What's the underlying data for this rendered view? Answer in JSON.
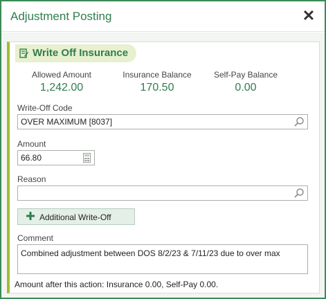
{
  "dialog": {
    "title": "Adjustment Posting",
    "close_symbol": "✕"
  },
  "section": {
    "title": "Write Off Insurance",
    "icon": "document-edit-icon"
  },
  "stats": [
    {
      "label": "Allowed Amount",
      "value": "1,242.00"
    },
    {
      "label": "Insurance Balance",
      "value": "170.50"
    },
    {
      "label": "Self-Pay Balance",
      "value": "0.00"
    }
  ],
  "form": {
    "writeoff_code": {
      "label": "Write-Off Code",
      "value": "OVER MAXIMUM [8037]"
    },
    "amount": {
      "label": "Amount",
      "value": "66.80"
    },
    "reason": {
      "label": "Reason",
      "value": ""
    },
    "additional_writeoff_label": "Additional Write-Off",
    "comment": {
      "label": "Comment",
      "value": "Combined adjustment between DOS 8/2/23 & 7/11/23 due to over max"
    }
  },
  "footer_note": "Amount after this action: Insurance 0.00, Self-Pay 0.00.",
  "colors": {
    "accent_green": "#2f7d4e",
    "section_bar": "#9bbf2f",
    "tab_bg": "#e7f0cf"
  }
}
